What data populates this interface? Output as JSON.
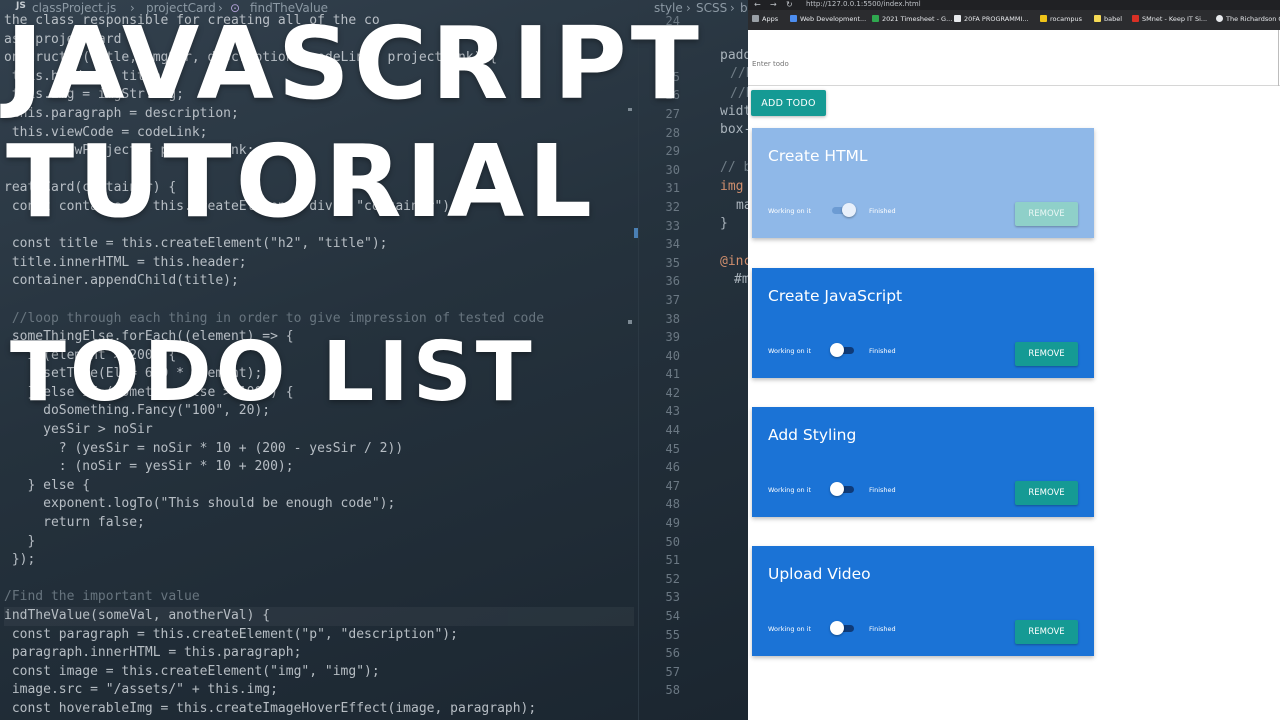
{
  "editor": {
    "tabs": [
      "JS",
      "classProject.js",
      "projectCard",
      "findTheValue"
    ],
    "code_lines": [
      "the class responsible for creating all of the co",
      "ass projectCard {",
      "onstructor(title, imgStr, description, codeLink, projectLink) {",
      " this.header = title;",
      " this.img = imgStr.img;",
      " this.paragraph = description;",
      " this.viewCode = codeLink;",
      " this.viewProject = projectLink;",
      "",
      "reateCard(container) {",
      " const container = this.createElement(\"div\", \"container\");",
      "",
      " const title = this.createElement(\"h2\", \"title\");",
      " title.innerHTML = this.header;",
      " container.appendChild(title);",
      "",
      " //loop through each thing in order to give impression of tested code",
      " someThingElse.forEach((element) => {",
      "   if(element > 200) {",
      "     setTime(El = 600 * element);",
      "   } else if (somethingElse > 1000) {",
      "     doSomething.Fancy(\"100\", 20);",
      "     yesSir > noSir",
      "       ? (yesSir = noSir * 10 + (200 - yesSir / 2))",
      "       : (noSir = yesSir * 10 + 200);",
      "   } else {",
      "     exponent.logTo(\"This should be enough code\");",
      "     return false;",
      "   }",
      " });",
      "",
      "/Find the important value",
      "indTheValue(someVal, anotherVal) {",
      " const paragraph = this.createElement(\"p\", \"description\");",
      " paragraph.innerHTML = this.paragraph;",
      " const image = this.createElement(\"img\", \"img\");",
      " image.src = \"/assets/\" + this.img;",
      " const hoverableImg = this.createImageHoverEffect(image, paragraph);"
    ],
    "right_tabs": [
      "style",
      "SCSS",
      "b"
    ],
    "right_line_numbers": [
      "24",
      "",
      "",
      "25",
      "26",
      "27",
      "28",
      "29",
      "30",
      "31",
      "32",
      "33",
      "34",
      "35",
      "36",
      "37",
      "38",
      "39",
      "40",
      "41",
      "42",
      "43",
      "44",
      "45",
      "46",
      "47",
      "48",
      "49",
      "50",
      "51",
      "52",
      "53",
      "54",
      "55",
      "56",
      "57",
      "58"
    ],
    "right_snippets": [
      "padd",
      "//ba",
      "//bo",
      "widt",
      "box-",
      "// b",
      "img",
      "ma",
      "}",
      "@inc",
      "#m"
    ]
  },
  "overlay_title": {
    "line1": "JAVASCRIPT",
    "line2": "TUTORIAL",
    "line3": "TODO LIST"
  },
  "browser": {
    "url": "http://127.0.0.1:5500/index.html",
    "bookmarks": [
      "Apps",
      "Web Development...",
      "2021 Timesheet - G...",
      "20FA PROGRAMMI...",
      "rocampus",
      "babel",
      "SMnet - Keep IT Si...",
      "The Richardson G"
    ],
    "input_placeholder": "Enter todo",
    "add_button": "ADD TODO",
    "label_working": "Working on it",
    "label_finished": "Finished",
    "remove_label": "REMOVE",
    "todos": [
      {
        "title": "Create HTML",
        "toggled": true
      },
      {
        "title": "Create JavaScript",
        "toggled": false
      },
      {
        "title": "Add Styling",
        "toggled": false
      },
      {
        "title": "Upload Video",
        "toggled": false
      }
    ]
  },
  "colors": {
    "card_active": "#1b73d6",
    "card_faded": "#8fb8e8",
    "button_teal": "#159a94",
    "button_teal_faded": "#8fd0c9",
    "editor_bg": "#25323d"
  }
}
